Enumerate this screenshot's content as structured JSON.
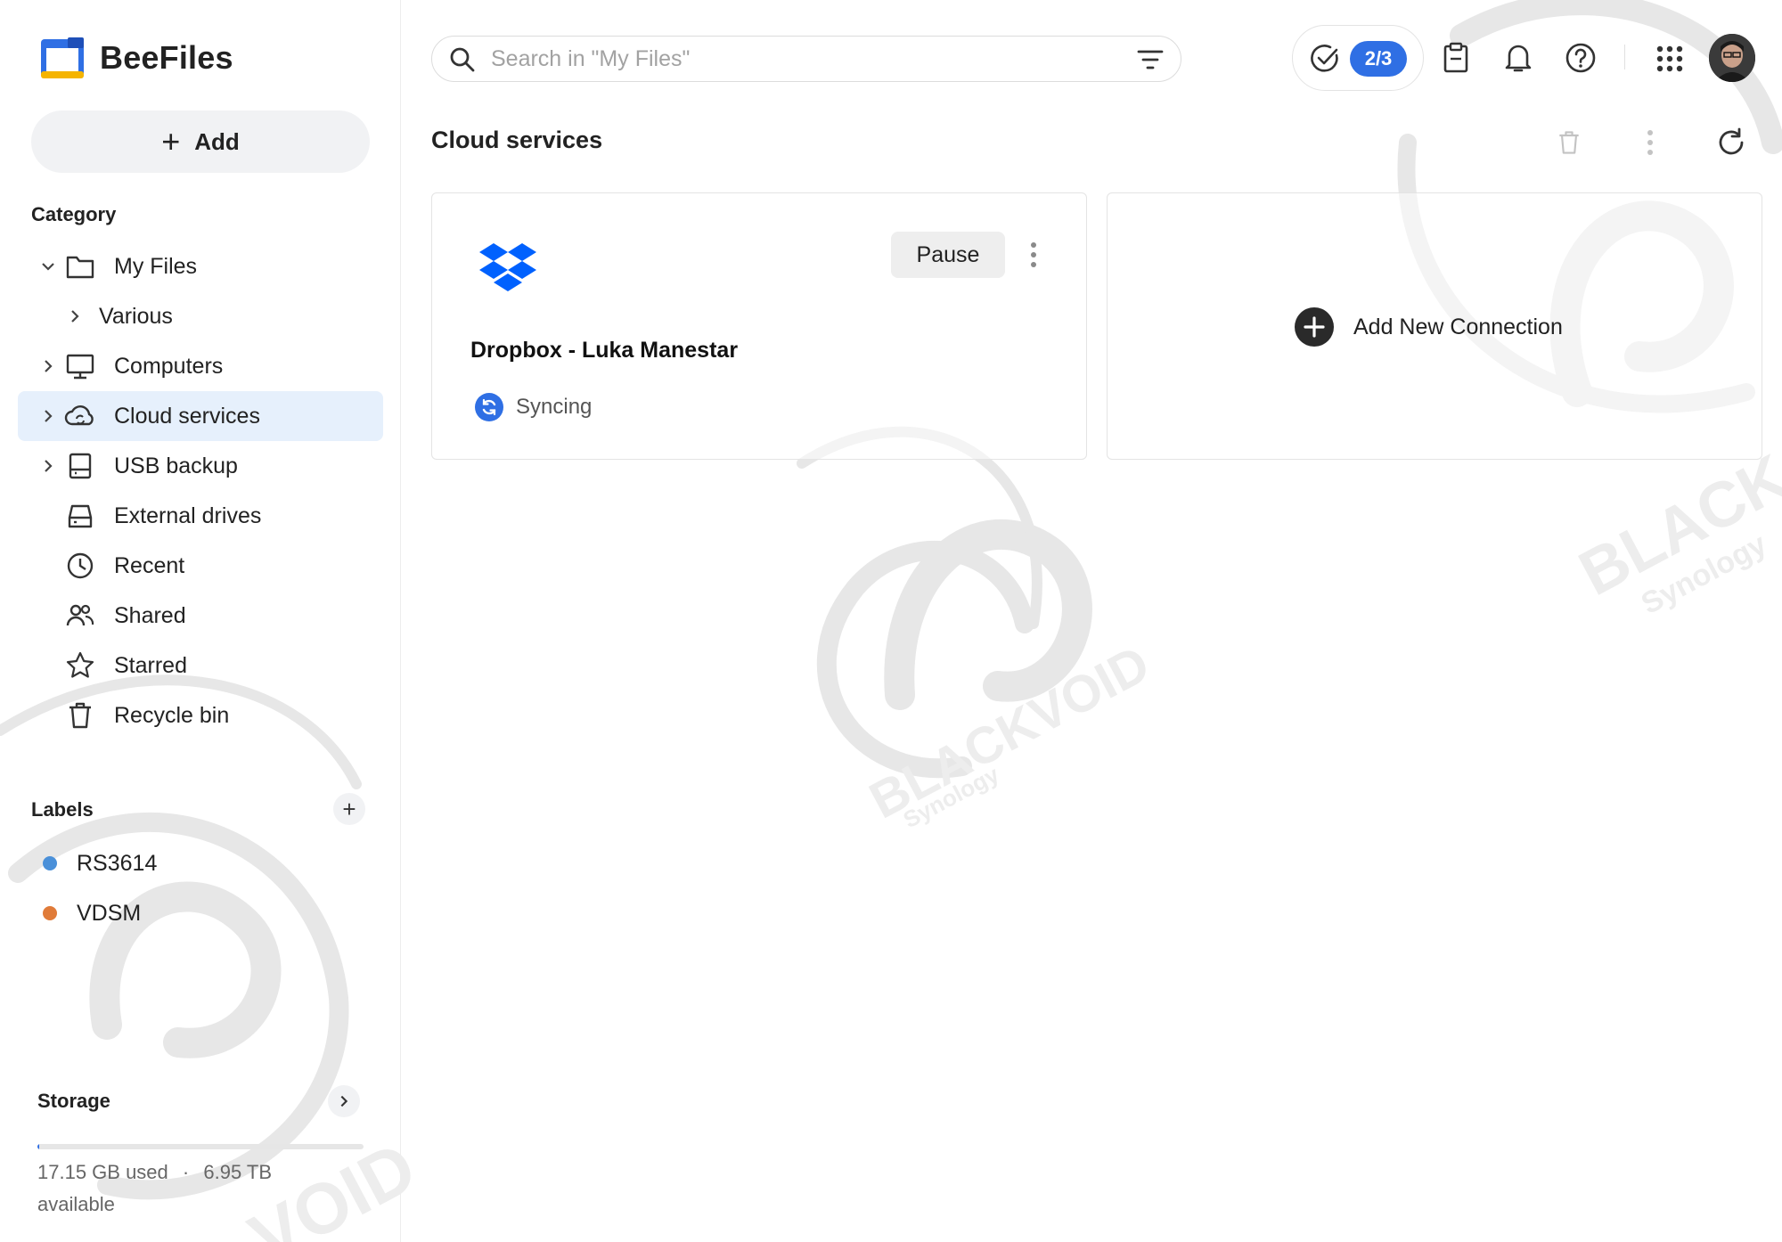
{
  "app": {
    "name": "BeeFiles"
  },
  "sidebar": {
    "add_label": "Add",
    "category_title": "Category",
    "items": [
      {
        "label": "My Files",
        "icon": "folder-icon"
      },
      {
        "label": "Various",
        "icon": ""
      },
      {
        "label": "Computers",
        "icon": "computer-icon"
      },
      {
        "label": "Cloud services",
        "icon": "cloud-sync-icon"
      },
      {
        "label": "USB backup",
        "icon": "usb-backup-icon"
      },
      {
        "label": "External drives",
        "icon": "external-drive-icon"
      },
      {
        "label": "Recent",
        "icon": "clock-icon"
      },
      {
        "label": "Shared",
        "icon": "people-icon"
      },
      {
        "label": "Starred",
        "icon": "star-icon"
      },
      {
        "label": "Recycle bin",
        "icon": "trash-icon"
      }
    ],
    "labels_title": "Labels",
    "labels": [
      {
        "name": "RS3614",
        "color": "#4a90d9"
      },
      {
        "name": "VDSM",
        "color": "#e07b39"
      }
    ],
    "storage": {
      "title": "Storage",
      "used": "17.15 GB used",
      "separator": "·",
      "available": "6.95 TB available",
      "used_fraction": 0.0025
    }
  },
  "search": {
    "placeholder": "Search in \"My Files\""
  },
  "tasks": {
    "badge": "2/3"
  },
  "main": {
    "title": "Cloud services",
    "connections": [
      {
        "name": "Dropbox - Luka Manestar",
        "status": "Syncing",
        "action": "Pause",
        "provider_icon": "dropbox-icon"
      }
    ],
    "add_connection_label": "Add New Connection"
  },
  "colors": {
    "accent": "#2f6fe4",
    "active_bg": "#e6f0fc",
    "dropbox": "#0061fe"
  }
}
